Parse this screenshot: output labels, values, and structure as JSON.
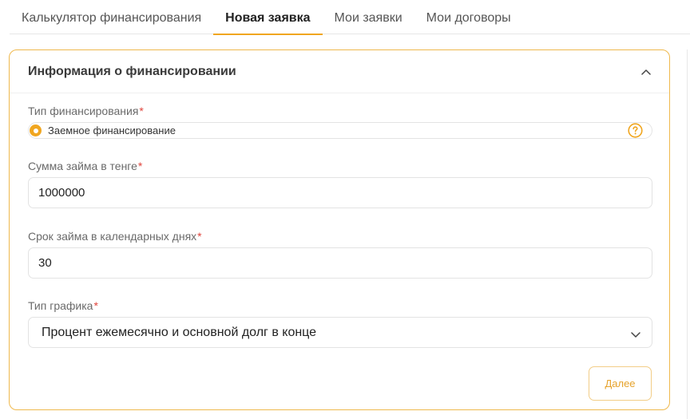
{
  "tabs": [
    {
      "label": "Калькулятор финансирования",
      "active": false
    },
    {
      "label": "Новая заявка",
      "active": true
    },
    {
      "label": "Мои заявки",
      "active": false
    },
    {
      "label": "Мои договоры",
      "active": false
    }
  ],
  "card": {
    "title": "Информация о финансировании",
    "collapse_icon": "chevron-up-icon"
  },
  "form": {
    "financing_type": {
      "label": "Тип финансирования",
      "required_mark": "*",
      "option": "Заемное финансирование",
      "selected": true,
      "help_icon": "question-circle-icon"
    },
    "loan_amount": {
      "label": "Сумма займа в тенге",
      "required_mark": "*",
      "value": "1000000"
    },
    "loan_term": {
      "label": "Срок займа в календарных днях",
      "required_mark": "*",
      "value": "30"
    },
    "schedule_type": {
      "label": "Тип графика",
      "required_mark": "*",
      "value": "Процент ежемесячно и основной долг в конце",
      "dropdown_icon": "chevron-down-icon"
    }
  },
  "actions": {
    "next_label": "Далее"
  },
  "colors": {
    "accent": "#f0a620",
    "required": "#e0443c",
    "card_border": "#efb94e"
  }
}
